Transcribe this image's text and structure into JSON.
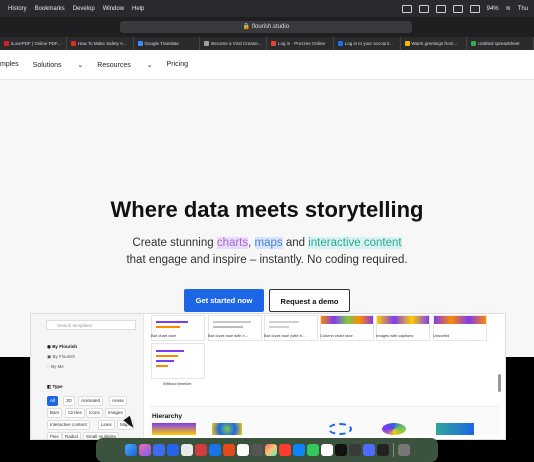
{
  "menubar": {
    "items": [
      "History",
      "Bookmarks",
      "Develop",
      "Window",
      "Help"
    ],
    "battery": "94%",
    "time": "Thu"
  },
  "browser": {
    "url": "flourish.studio",
    "tabs": [
      "iLovePDF | Online PDF...",
      "How To Make Safety A...",
      "Google Translate",
      "Become a Viral Creator...",
      "Log in · Prezzee Online",
      "Log in to your account...",
      "Warm greetings from...",
      "Untitled spreadsheet"
    ]
  },
  "nav": {
    "items": [
      "mples",
      "Solutions",
      "Resources",
      "Pricing"
    ]
  },
  "hero": {
    "title": "Where data meets storytelling",
    "subtitle_prefix": "Create stunning ",
    "highlight_charts": "charts",
    "comma": ", ",
    "highlight_maps": "maps",
    "and": " and ",
    "highlight_interactive": "interactive content",
    "subtitle_line2": "that engage and inspire – instantly. No coding required."
  },
  "cta": {
    "primary": "Get started now",
    "secondary": "Request a demo"
  },
  "templates": {
    "search_placeholder": "Search templates",
    "sidebar_items": [
      "By Flourish",
      "By Flourish",
      "By Me"
    ],
    "type_label": "Type",
    "pills_row1": [
      "All",
      "3D",
      "Animated",
      "Areas"
    ],
    "pills_row2": [
      "Bars",
      "Circles",
      "Icons",
      "Images"
    ],
    "pills_row3": [
      "Interactive content",
      "Lines",
      "Maps"
    ],
    "pills_row4": [
      "Pies",
      "Radial",
      "Small multiples"
    ],
    "row1_labels": [
      "Bar chart race",
      "Bar chart race with h...",
      "Bar chart race (with h...",
      "Column chart race",
      "Images with captions",
      "Unsorted"
    ],
    "row2_label": "Without timeline",
    "hierarchy": "Hierarchy"
  }
}
